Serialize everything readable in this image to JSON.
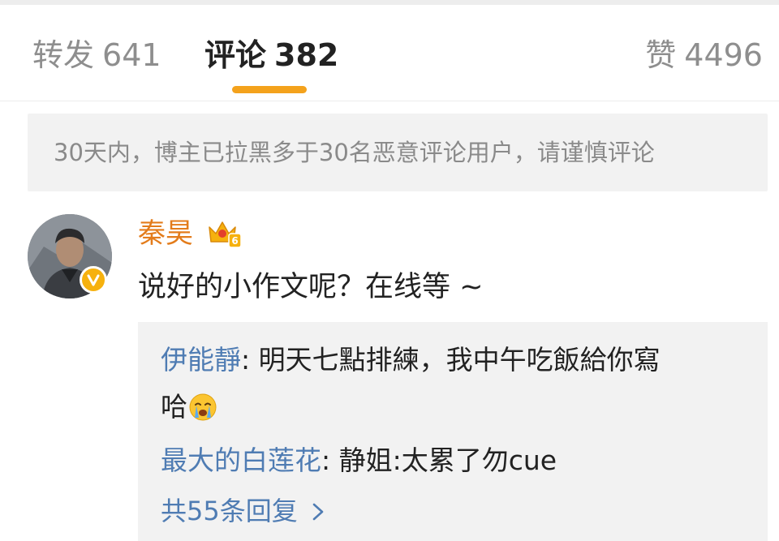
{
  "tabs": {
    "repost": {
      "label": "转发",
      "count": "641"
    },
    "comments": {
      "label": "评论",
      "count": "382"
    },
    "likes": {
      "label": "赞",
      "count": "4496"
    }
  },
  "accent_color": "#f4a21c",
  "notice": "30天内，博主已拉黑多于30名恶意评论用户，请谨慎评论",
  "comment": {
    "username": "秦昊",
    "username_color": "#e37c1b",
    "badge_icon": "verified-badge-icon",
    "level_icon": "crown-level-icon",
    "text": "说好的小作文呢？在线等 ~"
  },
  "replies": {
    "link_color": "#4f7cb3",
    "items": [
      {
        "author": "伊能靜",
        "separator": ": ",
        "text_line1": "明天七點排練，我中午吃飯給你寫",
        "text_line2": "哈",
        "emoji": "crying-face-emoji"
      },
      {
        "author": "最大的白莲花",
        "separator": ": ",
        "text": "静姐:太累了勿cue"
      }
    ],
    "more_label": "共55条回复"
  }
}
